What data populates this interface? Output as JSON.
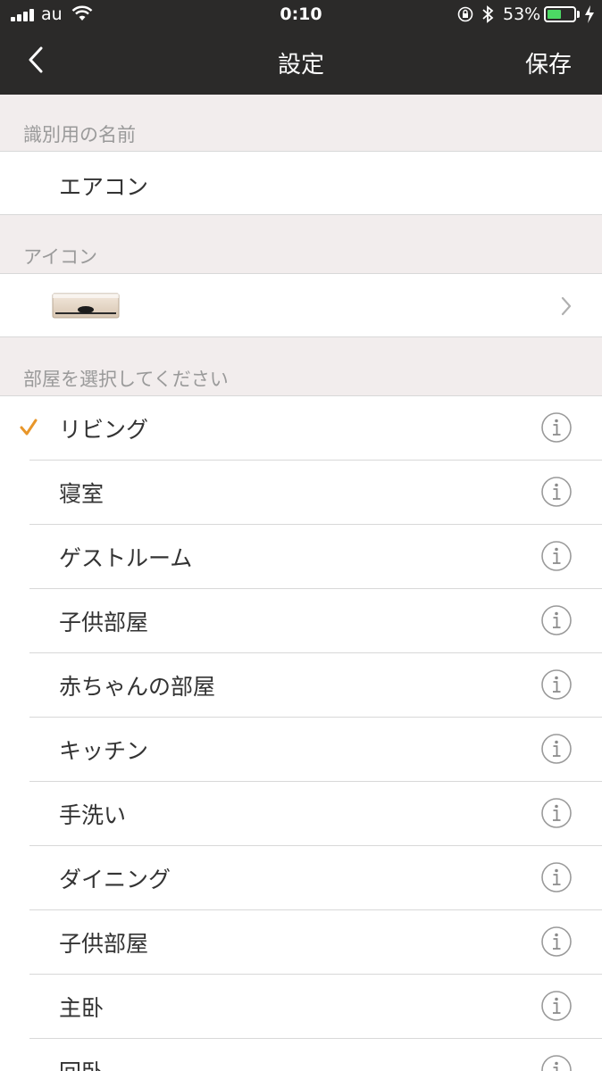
{
  "status_bar": {
    "carrier": "au",
    "time": "0:10",
    "battery_percent": "53%",
    "battery_level": 0.53
  },
  "nav": {
    "back_icon": "chevron-left-icon",
    "title": "設定",
    "save_label": "保存"
  },
  "name_section": {
    "header": "識別用の名前",
    "value": "エアコン"
  },
  "icon_section": {
    "header": "アイコン",
    "icon_name": "air-conditioner-icon"
  },
  "room_section": {
    "header": "部屋を選択してください",
    "rooms": [
      {
        "label": "リビング",
        "selected": true
      },
      {
        "label": "寝室",
        "selected": false
      },
      {
        "label": "ゲストルーム",
        "selected": false
      },
      {
        "label": "子供部屋",
        "selected": false
      },
      {
        "label": "赤ちゃんの部屋",
        "selected": false
      },
      {
        "label": "キッチン",
        "selected": false
      },
      {
        "label": "手洗い",
        "selected": false
      },
      {
        "label": "ダイニング",
        "selected": false
      },
      {
        "label": "子供部屋",
        "selected": false
      },
      {
        "label": "主卧",
        "selected": false
      },
      {
        "label": "回卧",
        "selected": false
      }
    ]
  },
  "colors": {
    "nav_bg": "#2b2a29",
    "accent": "#e8962a",
    "section_bg": "#f2eded",
    "separator": "#d8d8d8"
  }
}
